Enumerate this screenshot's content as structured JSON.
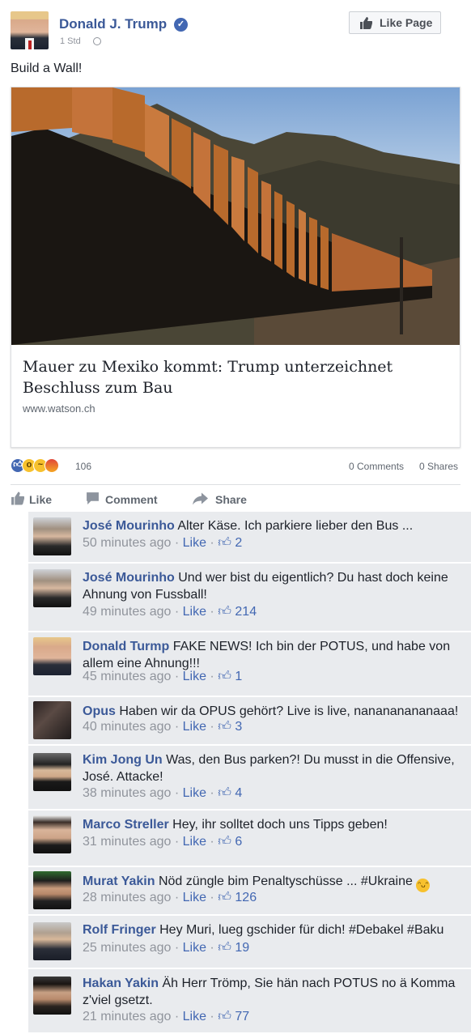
{
  "post": {
    "page_name": "Donald J. Trump",
    "time": "1 Std",
    "verified_icon": "verified-badge-icon",
    "like_page_label": "Like Page",
    "text": "Build a Wall!"
  },
  "link": {
    "title": "Mauer zu Mexiko kommt: Trump unterzeichnet Beschluss zum Bau",
    "domain": "www.watson.ch"
  },
  "stats": {
    "reaction_count": "106",
    "comments": "0 Comments",
    "shares": "0 Shares"
  },
  "actions": {
    "like": "Like",
    "comment": "Comment",
    "share": "Share"
  },
  "colors": {
    "link_blue": "#3b5998",
    "comment_bg": "#e9ebee",
    "meta_gray": "#90949c"
  },
  "comments": [
    {
      "name": "José Mourinho",
      "text": "Alter Käse. Ich parkiere lieber den Bus ...",
      "time": "50 minutes ago",
      "like": "Like",
      "likes": "2"
    },
    {
      "name": "José Mourinho",
      "text": "Und wer bist du eigentlich? Du hast doch keine Ahnung von Fussball!",
      "time": "49 minutes ago",
      "like": "Like",
      "likes": "214"
    },
    {
      "name": "Donald Turmp",
      "text": "FAKE NEWS! Ich bin der POTUS, und habe von allem eine Ahnung!!!",
      "time": "45 minutes ago",
      "like": "Like",
      "likes": "1"
    },
    {
      "name": "Opus",
      "text": "Haben wir da OPUS gehört? Live is live, nanananananaaa!",
      "time": "40 minutes ago",
      "like": "Like",
      "likes": "3"
    },
    {
      "name": "Kim Jong Un",
      "text": "Was, den Bus parken?! Du musst in die Offensive, José. Attacke!",
      "time": "38 minutes ago",
      "like": "Like",
      "likes": "4"
    },
    {
      "name": "Marco Streller",
      "text": "Hey, ihr solltet doch uns Tipps geben!",
      "time": "31 minutes ago",
      "like": "Like",
      "likes": "6"
    },
    {
      "name": "Murat Yakin",
      "text": "Nöd züngle bim Penaltyschüsse ... #Ukraine",
      "time": "28 minutes ago",
      "like": "Like",
      "likes": "126"
    },
    {
      "name": "Rolf Fringer",
      "text": "Hey Muri, lueg gschider für dich! #Debakel #Baku",
      "time": "25 minutes ago",
      "like": "Like",
      "likes": "19"
    },
    {
      "name": "Hakan Yakin",
      "text": "Äh Herr Trömp, Sie hän nach POTUS no ä Komma z'viel gsetzt.",
      "time": "21 minutes ago",
      "like": "Like",
      "likes": "77"
    }
  ]
}
